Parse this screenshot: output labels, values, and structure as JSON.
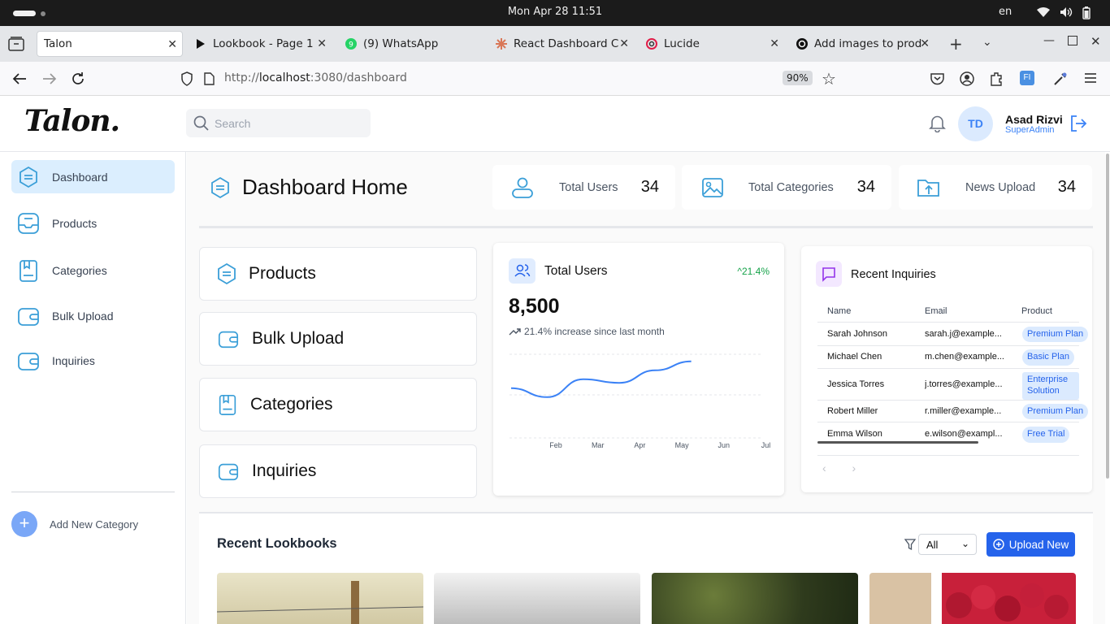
{
  "os": {
    "clock": "Mon Apr 28  11:51",
    "lang": "en"
  },
  "browser": {
    "tabs": [
      {
        "title": "Talon",
        "active": true
      },
      {
        "title": "Lookbook - Page 1"
      },
      {
        "title": "(9) WhatsApp"
      },
      {
        "title": "React Dashboard C"
      },
      {
        "title": "Lucide"
      },
      {
        "title": "Add images to prod"
      }
    ],
    "url_prefix": "http://",
    "url_host": "localhost",
    "url_rest": ":3080/dashboard",
    "zoom": "90%"
  },
  "header": {
    "logo": "Talon.",
    "search_placeholder": "Search",
    "avatar_initials": "TD",
    "user_name": "Asad Rizvi",
    "user_role": "SuperAdmin"
  },
  "sidebar": {
    "items": [
      {
        "label": "Dashboard",
        "active": true
      },
      {
        "label": "Products"
      },
      {
        "label": "Categories"
      },
      {
        "label": "Bulk Upload"
      },
      {
        "label": "Inquiries"
      }
    ],
    "add_category": "Add New Category"
  },
  "main": {
    "title": "Dashboard Home",
    "stats": [
      {
        "label": "Total Users",
        "value": "34"
      },
      {
        "label": "Total Categories",
        "value": "34"
      },
      {
        "label": "News Upload",
        "value": "34"
      }
    ],
    "quick_links": [
      "Products",
      "Bulk Upload",
      "Categories",
      "Inquiries"
    ],
    "users_card": {
      "title": "Total Users",
      "trend": "21.4%",
      "value": "8,500",
      "subtitle": "21.4% increase since last month"
    },
    "inquiries": {
      "title": "Recent Inquiries",
      "columns": [
        "Name",
        "Email",
        "Product"
      ],
      "rows": [
        {
          "name": "Sarah Johnson",
          "email": "sarah.j@example...",
          "product": "Premium Plan"
        },
        {
          "name": "Michael Chen",
          "email": "m.chen@example...",
          "product": "Basic Plan"
        },
        {
          "name": "Jessica Torres",
          "email": "j.torres@example...",
          "product": "Enterprise Solution"
        },
        {
          "name": "Robert Miller",
          "email": "r.miller@example...",
          "product": "Premium Plan"
        },
        {
          "name": "Emma Wilson",
          "email": "e.wilson@exampl...",
          "product": "Free Trial"
        }
      ],
      "pager": "‹ ›"
    },
    "lookbooks": {
      "title": "Recent Lookbooks",
      "filter_value": "All",
      "upload_label": "Upload New"
    }
  },
  "chart_data": {
    "type": "line",
    "x": [
      "",
      "Feb",
      "Mar",
      "Apr",
      "May",
      "Jun",
      "Jul"
    ],
    "xticks": [
      "Feb",
      "Mar",
      "Apr",
      "May",
      "Jun",
      "Jul"
    ],
    "series": [
      {
        "values": [
          0.62,
          0.52,
          0.72,
          0.68,
          0.82,
          0.92
        ]
      }
    ],
    "color": "#3b82f6",
    "grid": "dashed horizontal"
  }
}
